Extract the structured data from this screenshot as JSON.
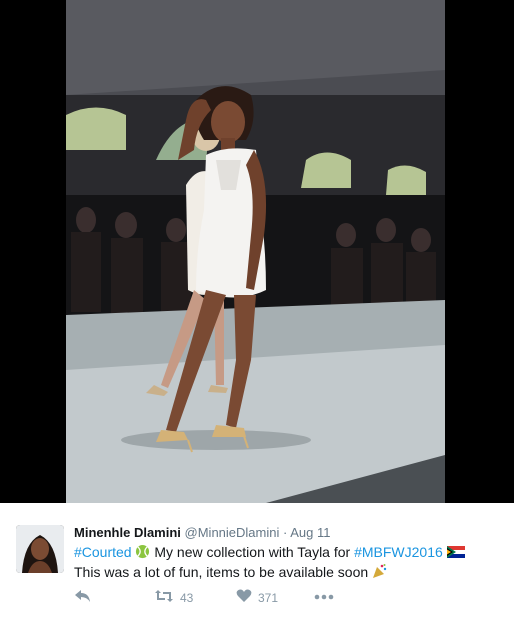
{
  "media": {
    "alt": "photo"
  },
  "tweet": {
    "display_name": "Minenhle Dlamini",
    "handle": "@MinnieDlamini",
    "separator": "·",
    "date": "Aug 11",
    "line1": {
      "hashtag1": "#Courted",
      "text1": "My new collection with Tayla for",
      "hashtag2": "#MBFWJ2016"
    },
    "line2": {
      "text": "This was a lot of fun, items to be available soon"
    }
  },
  "actions": {
    "retweet_count": "43",
    "like_count": "371"
  },
  "icons": {
    "reply": "reply-icon",
    "retweet": "retweet-icon",
    "like": "heart-icon",
    "more": "more-icon",
    "tennis": "tennis-ball-emoji",
    "flag": "south-africa-flag-emoji",
    "party": "party-popper-emoji"
  },
  "colors": {
    "link": "#1b95e0",
    "meta": "#657786",
    "action": "#8899a6",
    "name": "#14171a"
  }
}
